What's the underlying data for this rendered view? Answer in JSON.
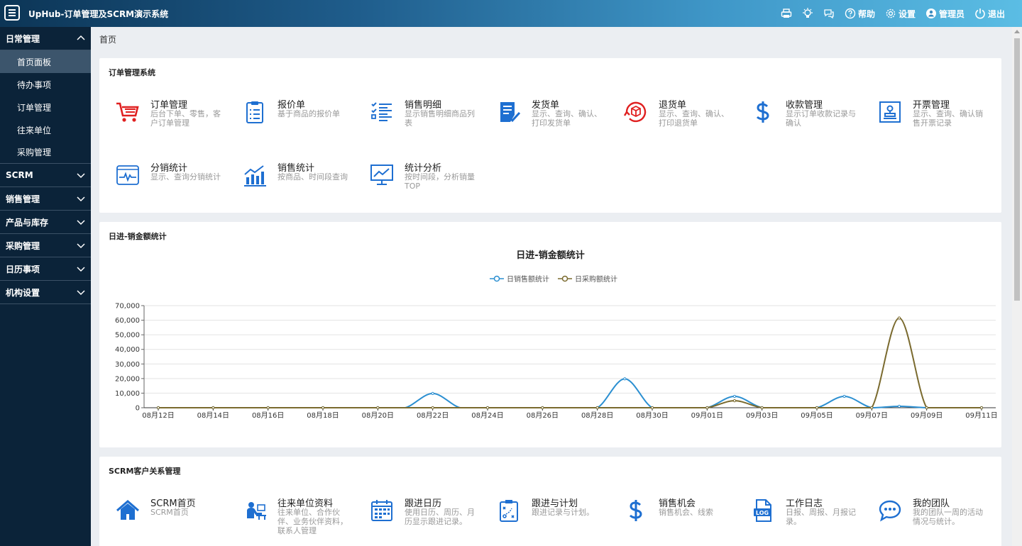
{
  "header": {
    "title": "UpHub-订单管理及SCRM演示系统",
    "tools": [
      {
        "icon": "printer-icon",
        "label": ""
      },
      {
        "icon": "bulb-icon",
        "label": ""
      },
      {
        "icon": "chat-icon",
        "label": ""
      },
      {
        "icon": "help-icon",
        "label": "帮助"
      },
      {
        "icon": "gear-icon",
        "label": "设置"
      },
      {
        "icon": "user-icon",
        "label": "管理员"
      },
      {
        "icon": "power-icon",
        "label": "退出"
      }
    ]
  },
  "sidebar": {
    "groups": [
      {
        "label": "日常管理",
        "expanded": true,
        "items": [
          "首页面板",
          "待办事项",
          "订单管理",
          "往来单位",
          "采购管理"
        ],
        "active": "首页面板"
      },
      {
        "label": "SCRM",
        "expanded": false
      },
      {
        "label": "销售管理",
        "expanded": false
      },
      {
        "label": "产品与库存",
        "expanded": false
      },
      {
        "label": "采购管理",
        "expanded": false
      },
      {
        "label": "日历事项",
        "expanded": false
      },
      {
        "label": "机构设置",
        "expanded": false
      }
    ]
  },
  "breadcrumb": "首页",
  "order_section": {
    "title": "订单管理系统",
    "tiles": [
      {
        "name": "订单管理",
        "desc": "后台下单、零售，客户订单管理",
        "icon": "cart-icon",
        "color": "#e02020"
      },
      {
        "name": "报价单",
        "desc": "基于商品的报价单",
        "icon": "clipboard-icon",
        "color": "#1e6fd1"
      },
      {
        "name": "销售明细",
        "desc": "显示销售明细商品列表",
        "icon": "checklist-icon",
        "color": "#1e6fd1"
      },
      {
        "name": "发货单",
        "desc": "显示、查询、确认、打印发货单",
        "icon": "document-check-icon",
        "color": "#1e6fd1"
      },
      {
        "name": "退货单",
        "desc": "显示、查询、确认、打印退货单",
        "icon": "return-box-icon",
        "color": "#e02020"
      },
      {
        "name": "收款管理",
        "desc": "显示订单收款记录与确认",
        "icon": "dollar-icon",
        "color": "#1e6fd1"
      },
      {
        "name": "开票管理",
        "desc": "显示、查询、确认销售开票记录",
        "icon": "stamp-icon",
        "color": "#1e6fd1"
      },
      {
        "name": "分销统计",
        "desc": "显示、查询分销统计",
        "icon": "pulse-window-icon",
        "color": "#1e6fd1"
      },
      {
        "name": "销售统计",
        "desc": "按商品、时间段查询",
        "icon": "bar-trend-icon",
        "color": "#1e6fd1"
      },
      {
        "name": "统计分析",
        "desc": "按时间段，分析销量TOP",
        "icon": "monitor-chart-icon",
        "color": "#1e6fd1"
      }
    ]
  },
  "chart_section": {
    "title": "日进-销金额统计"
  },
  "chart_data": {
    "type": "line",
    "title": "日进-销金额统计",
    "xlabel": "",
    "ylabel": "",
    "ylim": [
      0,
      70000
    ],
    "yticks": [
      "70,000",
      "60,000",
      "50,000",
      "40,000",
      "30,000",
      "20,000",
      "10,000",
      "0"
    ],
    "x": [
      "08月12日",
      "08月13日",
      "08月14日",
      "08月15日",
      "08月16日",
      "08月17日",
      "08月18日",
      "08月19日",
      "08月20日",
      "08月21日",
      "08月22日",
      "08月23日",
      "08月24日",
      "08月25日",
      "08月26日",
      "08月27日",
      "08月28日",
      "08月29日",
      "08月30日",
      "08月31日",
      "09月01日",
      "09月02日",
      "09月03日",
      "09月04日",
      "09月05日",
      "09月06日",
      "09月07日",
      "09月08日",
      "09月09日",
      "09月10日",
      "09月11日"
    ],
    "xtick_labels": [
      "08月12日",
      "08月14日",
      "08月16日",
      "08月18日",
      "08月20日",
      "08月22日",
      "08月24日",
      "08月26日",
      "08月28日",
      "08月30日",
      "09月01日",
      "09月03日",
      "09月05日",
      "09月07日",
      "09月09日",
      "09月11日"
    ],
    "grid": true,
    "legend_position": "top-center",
    "series": [
      {
        "name": "日销售额统计",
        "color": "#2b8fd1",
        "values": [
          0,
          0,
          0,
          0,
          0,
          0,
          0,
          0,
          0,
          0,
          9800,
          0,
          0,
          0,
          0,
          0,
          0,
          19800,
          0,
          0,
          0,
          7800,
          0,
          0,
          0,
          7800,
          0,
          1000,
          0,
          0,
          0
        ]
      },
      {
        "name": "日采购额统计",
        "color": "#7a6a2e",
        "values": [
          0,
          0,
          0,
          0,
          0,
          0,
          0,
          0,
          0,
          0,
          0,
          0,
          0,
          0,
          0,
          0,
          0,
          0,
          0,
          0,
          0,
          4800,
          0,
          0,
          0,
          0,
          0,
          61500,
          0,
          0,
          0
        ]
      }
    ]
  },
  "scrm_section": {
    "title": "SCRM客户关系管理",
    "tiles": [
      {
        "name": "SCRM首页",
        "desc": "SCRM首页",
        "icon": "home-icon",
        "color": "#1e6fd1"
      },
      {
        "name": "往来单位资料",
        "desc": "往来单位、合作伙伴、业务伙伴资料，联系人管理",
        "icon": "person-desk-icon",
        "color": "#1e6fd1"
      },
      {
        "name": "跟进日历",
        "desc": "使用日历、周历、月历显示跟进记录。",
        "icon": "calendar-icon",
        "color": "#1e6fd1"
      },
      {
        "name": "跟进与计划",
        "desc": "跟进记录与计划。",
        "icon": "strategy-board-icon",
        "color": "#1e6fd1"
      },
      {
        "name": "销售机会",
        "desc": "销售机会、线索",
        "icon": "dollar-icon",
        "color": "#1e6fd1"
      },
      {
        "name": "工作日志",
        "desc": "日报、周报、月报记录。",
        "icon": "log-file-icon",
        "color": "#1e6fd1"
      },
      {
        "name": "我的团队",
        "desc": "我的团队一周的活动情况与统计。",
        "icon": "chat-bubble-icon",
        "color": "#1e6fd1"
      }
    ]
  }
}
